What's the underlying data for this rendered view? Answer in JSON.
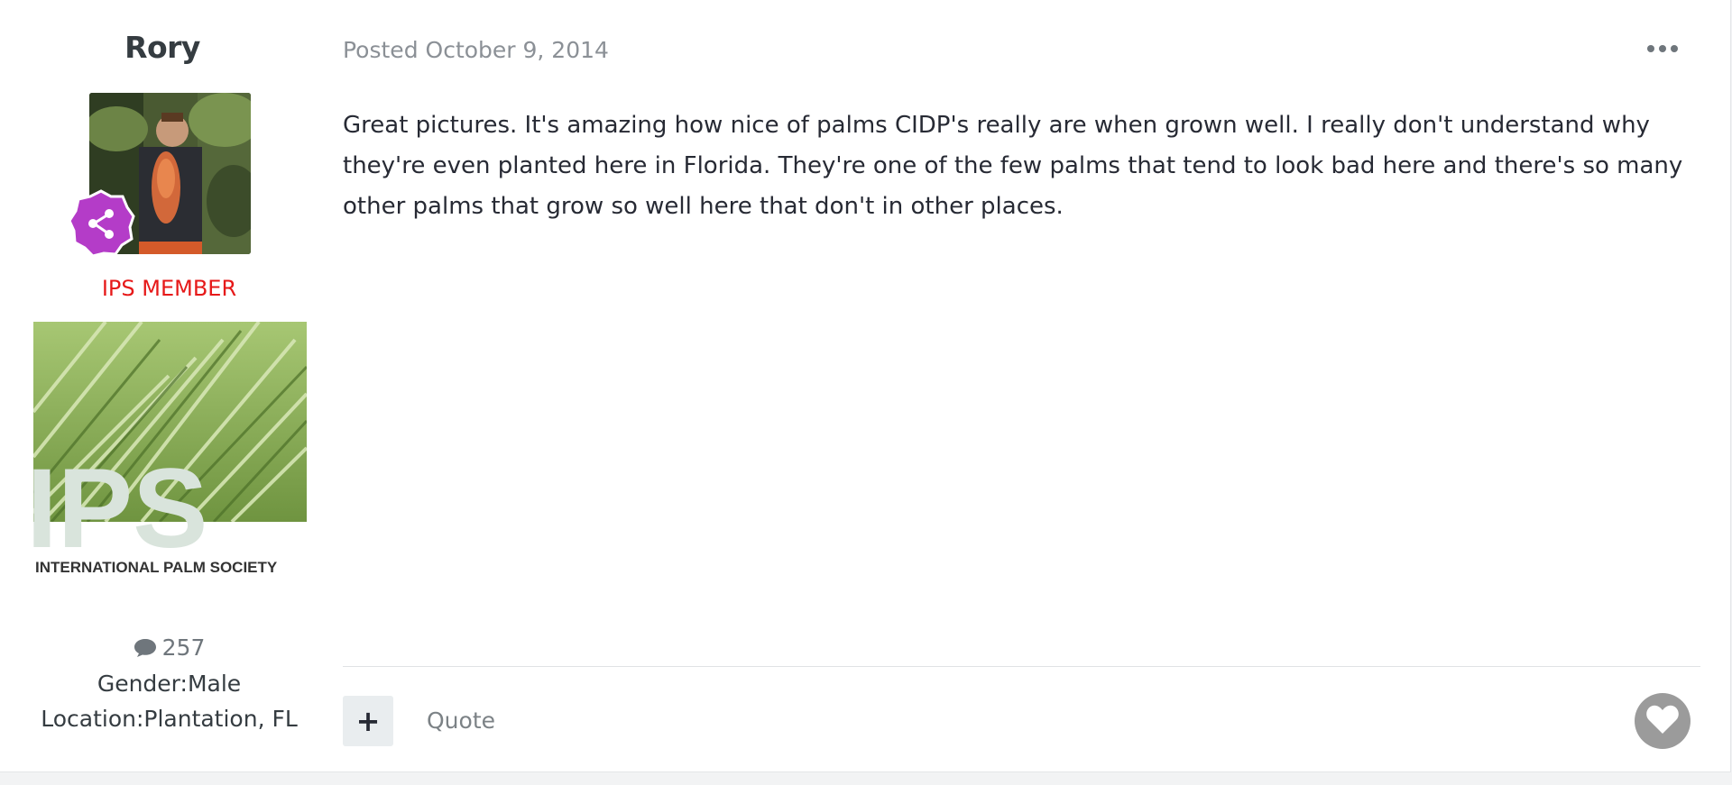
{
  "author": {
    "name": "Rory",
    "member_group": "IPS MEMBER",
    "group_image_text": "IPS",
    "group_image_caption": "INTERNATIONAL PALM SOCIETY",
    "post_count": "257",
    "gender": "Gender:Male",
    "location": "Location:Plantation, FL"
  },
  "post": {
    "posted_label": "Posted",
    "date": "October 9, 2014",
    "body": "Great pictures. It's amazing how nice of palms CIDP's really are when grown well. I really don't understand why they're even planted here in Florida. They're one of the few palms that tend to look bad here and there's so many other palms that grow so well here that don't in other places."
  },
  "actions": {
    "add_label": "+",
    "quote_label": "Quote"
  },
  "colors": {
    "member_group": "#e61919",
    "rank_badge": "#b43cc8",
    "like_button": "#9b9b9b"
  },
  "icons": {
    "more": "ellipsis-icon",
    "comment": "comment-icon",
    "heart": "heart-icon",
    "rank": "share-network-icon"
  }
}
